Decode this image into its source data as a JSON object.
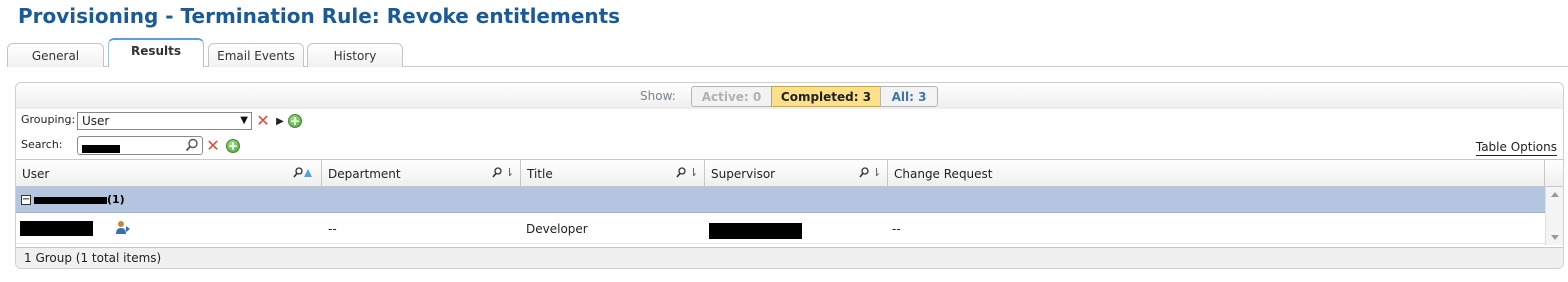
{
  "page": {
    "title": "Provisioning - Termination Rule: Revoke entitlements"
  },
  "tabs": [
    {
      "label": "General"
    },
    {
      "label": "Results",
      "active": true
    },
    {
      "label": "Email Events"
    },
    {
      "label": "History"
    }
  ],
  "filter": {
    "show_label": "Show:",
    "active": "Active: 0",
    "completed": "Completed: 3",
    "all": "All: 3",
    "selected": "completed"
  },
  "grouping": {
    "label": "Grouping:",
    "value": "User"
  },
  "search": {
    "label": "Search:"
  },
  "table_options": "Table Options",
  "columns": [
    {
      "label": "User"
    },
    {
      "label": "Department"
    },
    {
      "label": "Title"
    },
    {
      "label": "Supervisor"
    },
    {
      "label": "Change Request"
    }
  ],
  "group": {
    "count": "(1)"
  },
  "rows": [
    {
      "department": "--",
      "title": "Developer",
      "change_request": "--"
    }
  ],
  "footer": {
    "summary": "1 Group (1 total items)"
  },
  "colors": {
    "title": "#1a5a96",
    "group_row": "#b4c6df",
    "completed_bg": "#fde08a",
    "all_text": "#3f75ad"
  }
}
